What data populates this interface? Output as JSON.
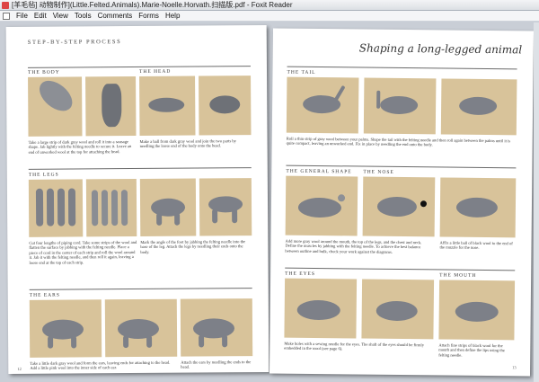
{
  "window": {
    "title": "[羊毛毡] 动物制作](Little.Felted.Animals).Marie-Noelle.Horvath.扫描版.pdf - Foxit Reader"
  },
  "menu": [
    "File",
    "Edit",
    "View",
    "Tools",
    "Comments",
    "Forms",
    "Help"
  ],
  "left_page": {
    "heading": "STEP-BY-STEP PROCESS",
    "sections": {
      "body": "THE BODY",
      "head": "THE HEAD",
      "legs": "THE LEGS",
      "ears": "THE EARS"
    },
    "texts": {
      "body": "Take a large strip of dark gray wool and roll it into a sausage shape. Jab lightly with the felting needle to secure it. Leave an end of unworked wool at the top for attaching the head.",
      "head": "Make a ball from dark gray wool and join the two parts by needling the loose end of the body onto the head.",
      "legs": "Cut four lengths of piping cord. Take some strips of the wool and flatten the surface by jabbing with the felting needle. Place a piece of cord in the center of each strip and roll the wool around it. Jab it with the felting needle, and then roll it again, leaving a loose end at the top of each strip.",
      "legs2": "Mark the angle of the foot by jabbing the felting needle into the base of the leg. Attach the legs by needling their ends onto the body.",
      "ears": "Take a little dark gray wool and form the ears, leaving ends for attaching to the head. Add a little pink wool into the inner side of each ear.",
      "ears2": "Attach the ears by needling the ends to the head."
    },
    "page_number": "12"
  },
  "right_page": {
    "title": "Shaping a long-legged animal",
    "sections": {
      "tail": "THE TAIL",
      "general": "THE GENERAL SHAPE",
      "nose": "THE NOSE",
      "eyes": "THE EYES",
      "mouth": "THE MOUTH"
    },
    "texts": {
      "tail": "Roll a thin strip of gray wool between your palms. Shape the tail with the felting needle and then roll again between the palms until it is quite compact, leaving an unworked end. Fix in place by needling the end onto the body.",
      "general": "Add more gray wool around the mouth, the top of the legs, and the chest and neck. Define the muscles by jabbing with the felting needle. To achieve the best balance between outline and bulk, check your work against the diagrams.",
      "nose": "Affix a little ball of black wool to the end of the muzzle for the nose.",
      "eyes": "Make holes with a sewing needle for the eyes. The shaft of the eyes should be firmly embedded in the wool (see page 6).",
      "mouth": "Attach fine strips of black wool for the mouth and then define the lips using the felting needle."
    },
    "page_number": "13"
  }
}
